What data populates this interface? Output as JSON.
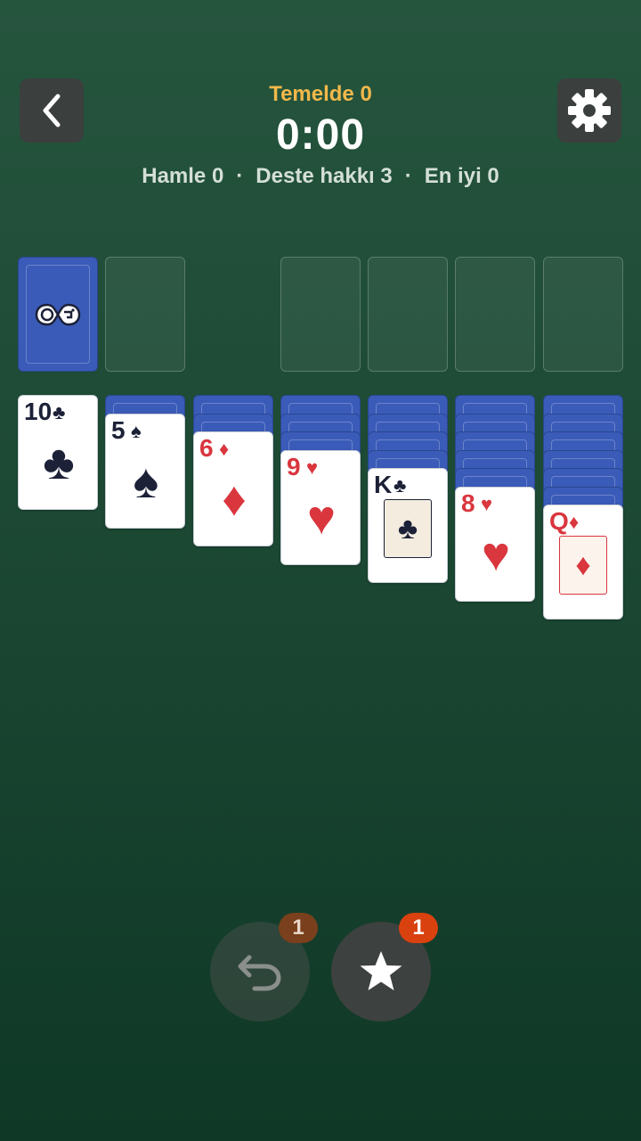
{
  "header": {
    "foundation_label": "Temelde 0",
    "timer": "0:00",
    "moves": "Hamle 0",
    "separator": "·",
    "deck_rounds": "Deste hakkı 3",
    "best": "En iyi 0"
  },
  "icons": {
    "back": "chevron-left-icon",
    "settings": "gear-icon",
    "undo": "undo-icon",
    "hint": "star-icon",
    "card_back_logo": "gamepad-logo-icon"
  },
  "tableau": [
    {
      "rank": "10",
      "suit": "♣",
      "color": "black",
      "hidden": 0
    },
    {
      "rank": "5",
      "suit": "♠",
      "color": "black",
      "hidden": 1
    },
    {
      "rank": "6",
      "suit": "♦",
      "color": "red",
      "hidden": 2
    },
    {
      "rank": "9",
      "suit": "♥",
      "color": "red",
      "hidden": 3
    },
    {
      "rank": "K",
      "suit": "♣",
      "color": "black",
      "hidden": 4
    },
    {
      "rank": "8",
      "suit": "♥",
      "color": "red",
      "hidden": 5
    },
    {
      "rank": "Q",
      "suit": "♦",
      "color": "red",
      "hidden": 6
    }
  ],
  "buttons": {
    "undo_count": "1",
    "hint_count": "1"
  },
  "colors": {
    "felt": "#1d4a35",
    "card_back": "#3a5bb8",
    "accent": "#f2b84a",
    "red_suit": "#d9363e",
    "black_suit": "#1c2137",
    "hint_badge": "#d9410f"
  }
}
